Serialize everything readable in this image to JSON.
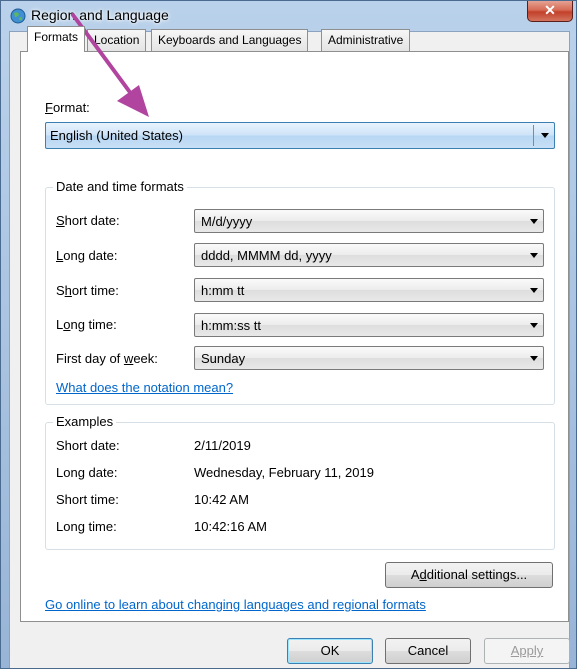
{
  "window": {
    "title": "Region and Language",
    "close_glyph": "✕"
  },
  "tabs": [
    {
      "label": "Formats",
      "active": true
    },
    {
      "label": "Location",
      "active": false
    },
    {
      "label": "Keyboards and Languages",
      "active": false
    },
    {
      "label": "Administrative",
      "active": false
    }
  ],
  "format": {
    "label_prefix": "",
    "label_access": "F",
    "label_rest": "ormat:",
    "value": "English (United States)"
  },
  "datetime": {
    "group_title": "Date and time formats",
    "short_date": {
      "label_access": "S",
      "label_rest": "hort date:",
      "value": "M/d/yyyy"
    },
    "long_date": {
      "label_access": "L",
      "label_rest": "ong date:",
      "value": "dddd, MMMM dd, yyyy"
    },
    "short_time": {
      "label_pre": "S",
      "label_access": "h",
      "label_rest": "ort time:",
      "value": "h:mm tt"
    },
    "long_time": {
      "label_pre": "L",
      "label_access": "o",
      "label_rest": "ng time:",
      "value": "h:mm:ss tt"
    },
    "first_day": {
      "label_pre": "First day of ",
      "label_access": "w",
      "label_rest": "eek:",
      "value": "Sunday"
    },
    "notation_link": "What does the notation mean?"
  },
  "examples": {
    "group_title": "Examples",
    "rows": [
      {
        "label": "Short date:",
        "value": "2/11/2019"
      },
      {
        "label": "Long date:",
        "value": "Wednesday, February 11, 2019"
      },
      {
        "label": "Short time:",
        "value": "10:42 AM"
      },
      {
        "label": "Long time:",
        "value": "10:42:16 AM"
      }
    ]
  },
  "additional_settings": {
    "pre": "A",
    "access": "d",
    "rest": "ditional settings..."
  },
  "online_link": "Go online to learn about changing languages and regional formats",
  "footer": {
    "ok": "OK",
    "cancel": "Cancel",
    "apply": "Apply"
  },
  "colors": {
    "annotation_arrow": "#b0449e",
    "link": "#0066cc",
    "selection": "#cde3f8"
  },
  "icons": {
    "window": "globe-icon",
    "annotation": "arrow-pointer-icon"
  }
}
